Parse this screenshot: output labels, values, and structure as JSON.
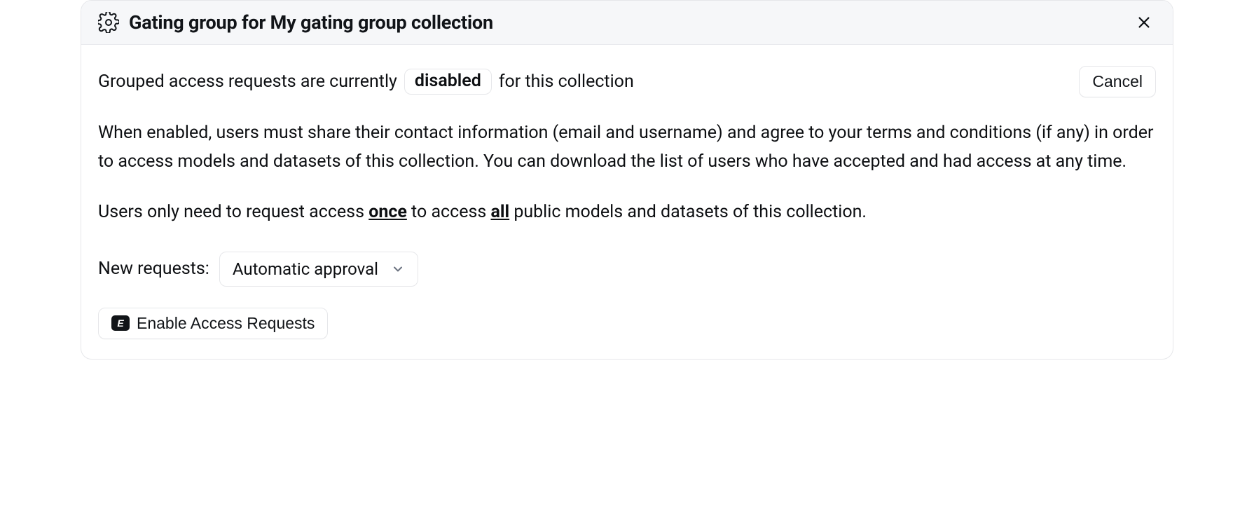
{
  "header": {
    "title": "Gating group for My gating group collection"
  },
  "status": {
    "prefix": "Grouped access requests are currently",
    "badge": "disabled",
    "suffix": "for this collection"
  },
  "actions": {
    "cancel_label": "Cancel",
    "enable_label": "Enable Access Requests"
  },
  "description": "When enabled, users must share their contact information (email and username) and agree to your terms and conditions (if any) in order to access models and datasets of this collection. You can download the list of users who have accepted and had access at any time.",
  "note": {
    "p1": "Users only need to request access ",
    "once": "once",
    "p2": " to access ",
    "all": "all",
    "p3": " public models and datasets of this collection."
  },
  "new_requests": {
    "label": "New requests:",
    "selected": "Automatic approval"
  },
  "icons": {
    "gating": "gating-icon",
    "close": "close-icon",
    "chevron_down": "chevron-down-icon",
    "enable_key": "E"
  }
}
